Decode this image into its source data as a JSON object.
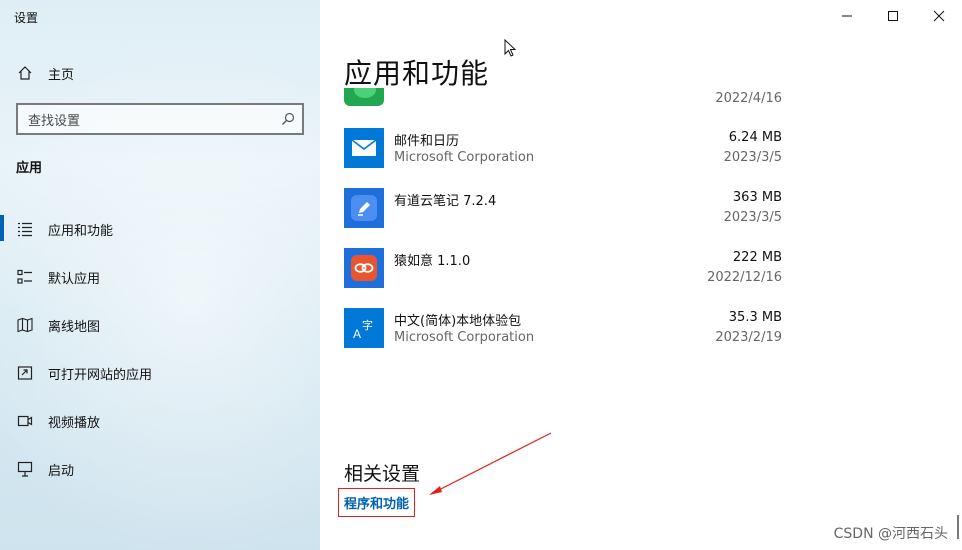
{
  "window": {
    "title": "设置"
  },
  "sidebar": {
    "home_label": "主页",
    "search_placeholder": "查找设置",
    "section": "应用",
    "items": [
      {
        "label": "应用和功能",
        "icon": "apps-features-icon",
        "active": true
      },
      {
        "label": "默认应用",
        "icon": "default-apps-icon"
      },
      {
        "label": "离线地图",
        "icon": "offline-maps-icon"
      },
      {
        "label": "可打开网站的应用",
        "icon": "apps-for-websites-icon"
      },
      {
        "label": "视频播放",
        "icon": "video-playback-icon"
      },
      {
        "label": "启动",
        "icon": "startup-icon"
      }
    ]
  },
  "main": {
    "title": "应用和功能",
    "partial_row": {
      "date": "2022/4/16"
    },
    "apps": [
      {
        "name": "邮件和日历",
        "publisher": "Microsoft Corporation",
        "size": "6.24 MB",
        "date": "2023/3/5",
        "icon": "mail-calendar-icon"
      },
      {
        "name": "有道云笔记 7.2.4",
        "publisher": "",
        "size": "363 MB",
        "date": "2023/3/5",
        "icon": "youdao-note-icon"
      },
      {
        "name": "猿如意 1.1.0",
        "publisher": "",
        "size": "222 MB",
        "date": "2022/12/16",
        "icon": "yuanruyi-icon"
      },
      {
        "name": "中文(简体)本地体验包",
        "publisher": "Microsoft Corporation",
        "size": "35.3 MB",
        "date": "2023/2/19",
        "icon": "language-pack-icon"
      }
    ],
    "related_heading": "相关设置",
    "related_link": "程序和功能"
  },
  "watermark": "CSDN @河西石头",
  "colors": {
    "accent": "#0063b1",
    "annotation": "#e0201a"
  }
}
